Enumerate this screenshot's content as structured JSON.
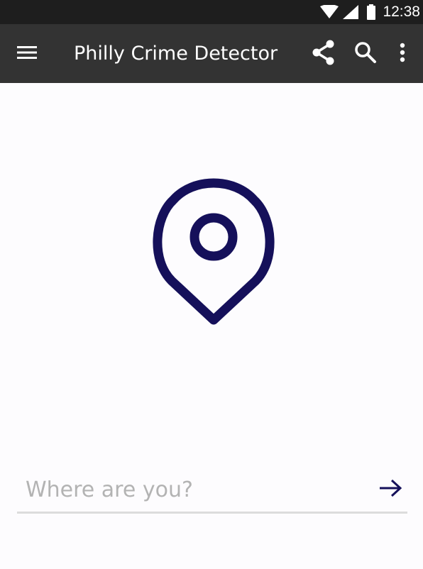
{
  "status_bar": {
    "time": "12:38",
    "icons": [
      "wifi-icon",
      "signal-icon",
      "battery-icon"
    ]
  },
  "app_bar": {
    "title": "Philly Crime Detector",
    "background": "#333333",
    "actions": [
      "menu-icon",
      "share-icon",
      "search-icon",
      "more-vert-icon"
    ]
  },
  "hero": {
    "icon": "location-pin-icon",
    "color": "#15105a"
  },
  "location_form": {
    "placeholder": "Where are you?",
    "value": "",
    "submit_icon": "arrow-right-icon"
  },
  "colors": {
    "accent": "#15105a",
    "placeholder": "#b3b3b3",
    "underline": "#dcdcdc",
    "background": "#fdfcfe"
  }
}
